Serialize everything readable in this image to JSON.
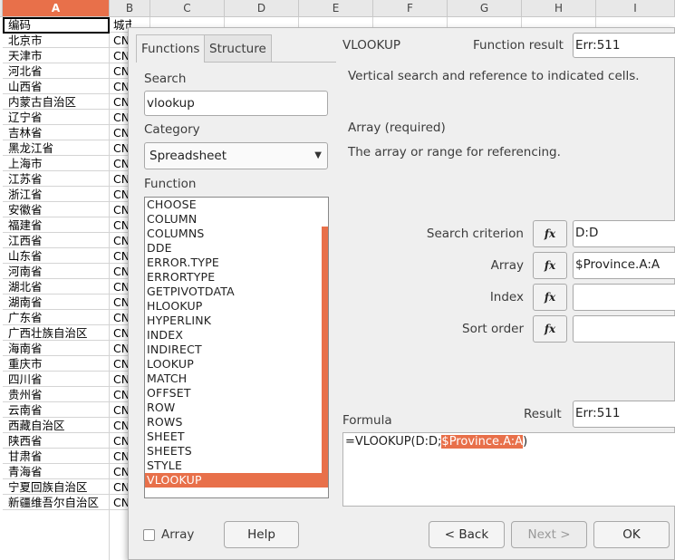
{
  "sheet": {
    "columns": [
      "A",
      "B",
      "C",
      "D",
      "E",
      "F",
      "G",
      "H",
      "I"
    ],
    "active_column": "A",
    "header_row": {
      "a": "编码",
      "b": "城市"
    },
    "rows": [
      {
        "a": "北京市",
        "b": "CN"
      },
      {
        "a": "天津市",
        "b": "CN"
      },
      {
        "a": "河北省",
        "b": "CN"
      },
      {
        "a": "山西省",
        "b": "CN"
      },
      {
        "a": "内蒙古自治区",
        "b": "CN"
      },
      {
        "a": "辽宁省",
        "b": "CN"
      },
      {
        "a": "吉林省",
        "b": "CN"
      },
      {
        "a": "黑龙江省",
        "b": "CN"
      },
      {
        "a": "上海市",
        "b": "CN"
      },
      {
        "a": "江苏省",
        "b": "CN"
      },
      {
        "a": "浙江省",
        "b": "CN"
      },
      {
        "a": "安徽省",
        "b": "CN"
      },
      {
        "a": "福建省",
        "b": "CN"
      },
      {
        "a": "江西省",
        "b": "CN"
      },
      {
        "a": "山东省",
        "b": "CN"
      },
      {
        "a": "河南省",
        "b": "CN"
      },
      {
        "a": "湖北省",
        "b": "CN"
      },
      {
        "a": "湖南省",
        "b": "CN"
      },
      {
        "a": "广东省",
        "b": "CN"
      },
      {
        "a": "广西壮族自治区",
        "b": "CN"
      },
      {
        "a": "海南省",
        "b": "CN"
      },
      {
        "a": "重庆市",
        "b": "CN"
      },
      {
        "a": "四川省",
        "b": "CN"
      },
      {
        "a": "贵州省",
        "b": "CN"
      },
      {
        "a": "云南省",
        "b": "CN"
      },
      {
        "a": "西藏自治区",
        "b": "CN"
      },
      {
        "a": "陕西省",
        "b": "CN"
      },
      {
        "a": "甘肃省",
        "b": "CN"
      },
      {
        "a": "青海省",
        "b": "CN"
      },
      {
        "a": "宁夏回族自治区",
        "b": "CN"
      },
      {
        "a": "新疆维吾尔自治区",
        "b": "CN"
      }
    ]
  },
  "dialog": {
    "tabs": [
      "Functions",
      "Structure"
    ],
    "active_tab": "Functions",
    "search": {
      "label": "Search",
      "value": "vlookup"
    },
    "category": {
      "label": "Category",
      "value": "Spreadsheet",
      "arrow_icon": "triangle-down-icon"
    },
    "function_list": {
      "label": "Function",
      "items": [
        "CHOOSE",
        "COLUMN",
        "COLUMNS",
        "DDE",
        "ERROR.TYPE",
        "ERRORTYPE",
        "GETPIVOTDATA",
        "HLOOKUP",
        "HYPERLINK",
        "INDEX",
        "INDIRECT",
        "LOOKUP",
        "MATCH",
        "OFFSET",
        "ROW",
        "ROWS",
        "SHEET",
        "SHEETS",
        "STYLE",
        "VLOOKUP"
      ],
      "selected": "VLOOKUP"
    },
    "function_name": "VLOOKUP",
    "function_result_label": "Function result",
    "function_result_value": "Err:511",
    "description": "Vertical search and reference to indicated cells.",
    "param_title": "Array (required)",
    "param_description": "The array or range for referencing.",
    "args": [
      {
        "label": "Search criterion",
        "value": "D:D"
      },
      {
        "label": "Array",
        "value": "$Province.A:A"
      },
      {
        "label": "Index",
        "value": ""
      },
      {
        "label": "Sort order",
        "value": ""
      }
    ],
    "fx_button_icon": "function-wizard-icon",
    "result_label": "Result",
    "result_value": "Err:511",
    "formula_label": "Formula",
    "formula": {
      "prefix": "=VLOOKUP(D:D;",
      "highlight": "$Province.A:A",
      "suffix": ")"
    },
    "array_checkbox_label": "Array",
    "buttons": {
      "help": "Help",
      "back": "< Back",
      "next": "Next >",
      "ok": "OK"
    },
    "accent_color": "#e8704a"
  }
}
